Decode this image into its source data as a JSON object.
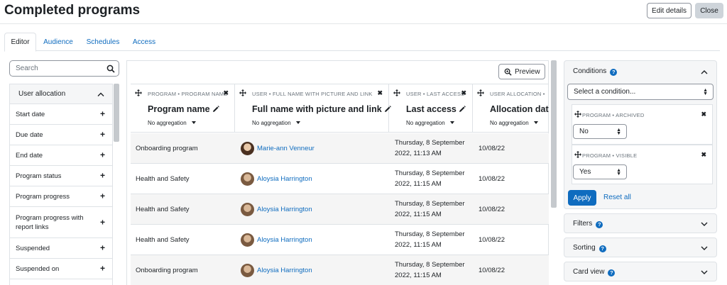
{
  "header": {
    "title": "Completed programs",
    "edit_details": "Edit details",
    "close": "Close"
  },
  "tabs": [
    {
      "label": "Editor",
      "active": true
    },
    {
      "label": "Audience"
    },
    {
      "label": "Schedules"
    },
    {
      "label": "Access"
    }
  ],
  "sidebar": {
    "search_placeholder": "Search",
    "section_label": "User allocation",
    "items": [
      {
        "label": "Start date"
      },
      {
        "label": "Due date"
      },
      {
        "label": "End date"
      },
      {
        "label": "Program status"
      },
      {
        "label": "Program progress"
      },
      {
        "label": "Program progress with report links"
      },
      {
        "label": "Suspended"
      },
      {
        "label": "Suspended on"
      }
    ]
  },
  "preview_label": "Preview",
  "columns": [
    {
      "category": "PROGRAM • PROGRAM NAME",
      "title": "Program name",
      "aggregation": "No aggregation"
    },
    {
      "category": "USER • FULL NAME WITH PICTURE AND LINK",
      "title": "Full name with picture and link",
      "aggregation": "No aggregation"
    },
    {
      "category": "USER • LAST ACCESS",
      "title": "Last access",
      "aggregation": "No aggregation"
    },
    {
      "category": "USER ALLOCATION •",
      "title": "Allocation dat",
      "aggregation": "No aggregation"
    }
  ],
  "rows": [
    {
      "program": "Onboarding program",
      "user": "Marie-ann Venneur",
      "last_access_1": "Thursday, 8 September",
      "last_access_2": "2022, 11:13 AM",
      "allocation": "10/08/22"
    },
    {
      "program": "Health and Safety",
      "user": "Aloysia Harrington",
      "last_access_1": "Thursday, 8 September",
      "last_access_2": "2022, 11:15 AM",
      "allocation": "10/08/22"
    },
    {
      "program": "Health and Safety",
      "user": "Aloysia Harrington",
      "last_access_1": "Thursday, 8 September",
      "last_access_2": "2022, 11:15 AM",
      "allocation": "10/08/22"
    },
    {
      "program": "Health and Safety",
      "user": "Aloysia Harrington",
      "last_access_1": "Thursday, 8 September",
      "last_access_2": "2022, 11:15 AM",
      "allocation": "10/08/22"
    },
    {
      "program": "Onboarding program",
      "user": "Aloysia Harrington",
      "last_access_1": "Thursday, 8 September",
      "last_access_2": "2022, 11:15 AM",
      "allocation": "10/08/22"
    }
  ],
  "conditions": {
    "title": "Conditions",
    "select_placeholder": "Select a condition...",
    "items": [
      {
        "category": "PROGRAM • ARCHIVED",
        "value": "No"
      },
      {
        "category": "PROGRAM • VISIBLE",
        "value": "Yes"
      }
    ],
    "apply": "Apply",
    "reset": "Reset all"
  },
  "panels": [
    {
      "title": "Filters"
    },
    {
      "title": "Sorting"
    },
    {
      "title": "Card view"
    }
  ],
  "colors": {
    "link": "#0f6cbf",
    "apply_bg": "#0f6cbf",
    "row_alt": "#f5f5f5"
  }
}
